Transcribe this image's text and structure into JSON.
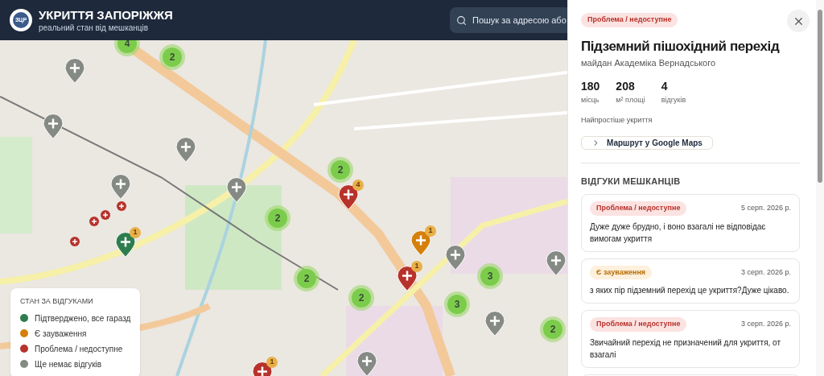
{
  "header": {
    "logo": "ЗЦР",
    "title": "УКРИТТЯ ЗАПОРІЖЖЯ",
    "subtitle": "реальний стан від мешканців",
    "search": {
      "placeholder": "Пошук за адресою або"
    }
  },
  "map": {
    "markers": [
      {
        "kind": "cluster",
        "count": "4"
      },
      {
        "kind": "cluster",
        "count": "2"
      },
      {
        "kind": "cluster",
        "count": "2"
      },
      {
        "kind": "cluster",
        "count": "2"
      },
      {
        "kind": "cluster",
        "count": "2"
      },
      {
        "kind": "cluster",
        "count": "2"
      },
      {
        "kind": "cluster",
        "count": "3"
      },
      {
        "kind": "cluster",
        "count": "3"
      },
      {
        "kind": "cluster",
        "count": "2"
      },
      {
        "kind": "pin",
        "color": "#858a85"
      },
      {
        "kind": "pin",
        "color": "#858a85"
      },
      {
        "kind": "pin",
        "color": "#858a85"
      },
      {
        "kind": "pin",
        "color": "#858a85"
      },
      {
        "kind": "pin",
        "color": "#858a85"
      },
      {
        "kind": "pin",
        "color": "#858a85"
      },
      {
        "kind": "pin",
        "color": "#858a85"
      },
      {
        "kind": "pin",
        "color": "#858a85"
      },
      {
        "kind": "pin",
        "color": "#858a85"
      },
      {
        "kind": "pin",
        "color": "#b8322c",
        "badge": "4"
      },
      {
        "kind": "pin",
        "color": "#b8322c",
        "badge": "1"
      },
      {
        "kind": "pin",
        "color": "#b8322c",
        "badge": "1"
      },
      {
        "kind": "pin",
        "color": "#d4800b",
        "badge": "1"
      },
      {
        "kind": "pin",
        "color": "#2e7d4f",
        "badge": "1"
      },
      {
        "kind": "dot",
        "color": "#b8322c"
      },
      {
        "kind": "dot",
        "color": "#b8322c"
      },
      {
        "kind": "dot",
        "color": "#b8322c"
      },
      {
        "kind": "dot",
        "color": "#b8322c"
      }
    ],
    "legend": {
      "title": "СТАН ЗА ВІДГУКАМИ",
      "items": [
        {
          "label": "Підтверджено, все гаразд",
          "color": "#2e7d4f"
        },
        {
          "label": "Є зауваження",
          "color": "#d4800b"
        },
        {
          "label": "Проблема / недоступне",
          "color": "#b8322c"
        },
        {
          "label": "Ще немає відгуків",
          "color": "#858a85"
        }
      ]
    }
  },
  "panel": {
    "status": {
      "label": "Проблема / недоступне",
      "kind": "problem"
    },
    "title": "Підземний пішохідний перехід",
    "address": "майдан Академіка Вернадського",
    "stats": [
      {
        "value": "180",
        "label": "місць"
      },
      {
        "value": "208",
        "label": "м² площі"
      },
      {
        "value": "4",
        "label": "відгуків"
      }
    ],
    "type": "Найпростіше укриття",
    "route_button": "Маршрут у Google Maps",
    "reviews_heading": "ВІДГУКИ МЕШКАНЦІВ",
    "reviews": [
      {
        "status": {
          "label": "Проблема / недоступне",
          "kind": "problem"
        },
        "date": "5 серп. 2026 р.",
        "text": "Дуже дуже брудно, і воно взагалі не відповідає вимогам укриття"
      },
      {
        "status": {
          "label": "Є зауваження",
          "kind": "remarks"
        },
        "date": "3 серп. 2026 р.",
        "text": "з яких пір підземний перехід це укриття?Дуже цікаво."
      },
      {
        "status": {
          "label": "Проблема / недоступне",
          "kind": "problem"
        },
        "date": "3 серп. 2026 р.",
        "text": "Звичайний перехід не призначений для укриття, от взагалі"
      }
    ]
  }
}
